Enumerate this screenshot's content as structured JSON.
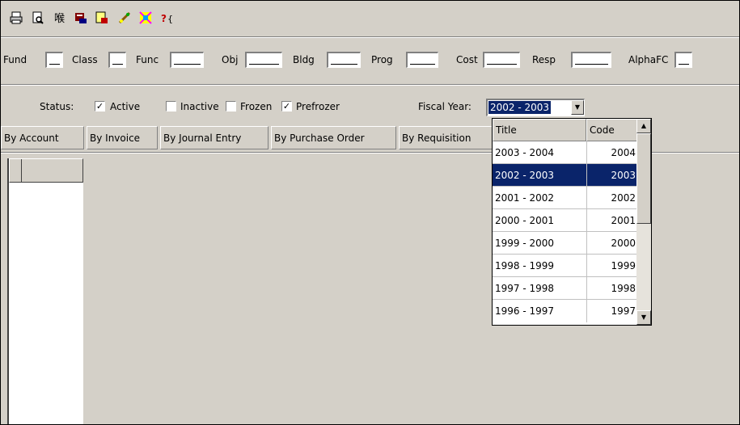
{
  "toolbar": {
    "icons": [
      "print-icon",
      "print-preview-icon",
      "spell-icon",
      "export-icon",
      "find-icon",
      "edit-icon",
      "setup-icon",
      "help-icon"
    ]
  },
  "filters": {
    "fund": "Fund",
    "class": "Class",
    "func": "Func",
    "obj": "Obj",
    "bldg": "Bldg",
    "prog": "Prog",
    "cost": "Cost",
    "resp": "Resp",
    "alpha_fc": "AlphaFC"
  },
  "status": {
    "label": "Status:",
    "active": {
      "label": "Active",
      "checked": true
    },
    "inactive": {
      "label": "Inactive",
      "checked": false
    },
    "frozen": {
      "label": "Frozen",
      "checked": false
    },
    "prefrozer": {
      "label": "Prefrozer",
      "checked": true
    },
    "fiscal_year_label": "Fiscal Year:",
    "fiscal_year_value": "2002 - 2003"
  },
  "tabs": [
    "By Account",
    "By Invoice",
    "By Journal Entry",
    "By Purchase Order",
    "By Requisition"
  ],
  "dropdown": {
    "col_title": "Title",
    "col_code": "Code",
    "rows": [
      {
        "title": "2003 - 2004",
        "code": "2004"
      },
      {
        "title": "2002 - 2003",
        "code": "2003"
      },
      {
        "title": "2001 - 2002",
        "code": "2002"
      },
      {
        "title": "2000 - 2001",
        "code": "2001"
      },
      {
        "title": "1999 - 2000",
        "code": "2000"
      },
      {
        "title": "1998 - 1999",
        "code": "1999"
      },
      {
        "title": "1997 - 1998",
        "code": "1998"
      },
      {
        "title": "1996 - 1997",
        "code": "1997"
      }
    ],
    "selected_index": 1
  },
  "colors": {
    "selection": "#0a246a",
    "window": "#d4d0c8"
  }
}
